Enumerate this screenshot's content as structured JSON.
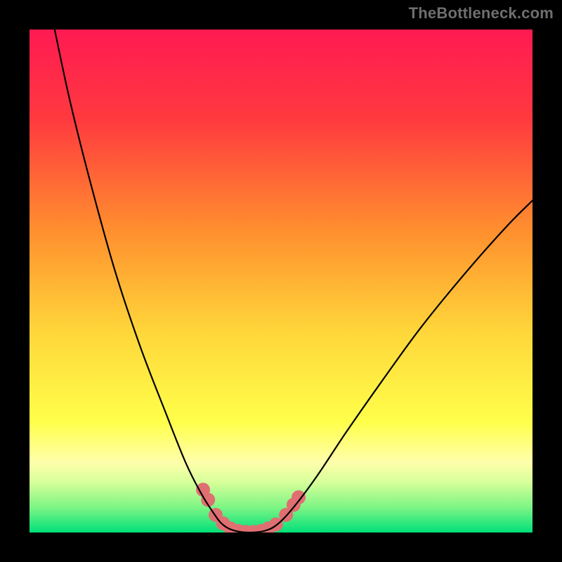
{
  "watermark": "TheBottleneck.com",
  "chart_data": {
    "type": "line",
    "title": "",
    "xlabel": "",
    "ylabel": "",
    "xlim": [
      0,
      100
    ],
    "ylim": [
      0,
      100
    ],
    "background_gradient_stops": [
      {
        "offset": 0,
        "color": "#ff1a52"
      },
      {
        "offset": 0.18,
        "color": "#ff3a3f"
      },
      {
        "offset": 0.4,
        "color": "#ff8f2e"
      },
      {
        "offset": 0.6,
        "color": "#ffd63a"
      },
      {
        "offset": 0.78,
        "color": "#ffff4a"
      },
      {
        "offset": 0.86,
        "color": "#ffffab"
      },
      {
        "offset": 0.9,
        "color": "#d7ff9a"
      },
      {
        "offset": 0.95,
        "color": "#7cf584"
      },
      {
        "offset": 1.0,
        "color": "#00e07a"
      }
    ],
    "curve": {
      "name": "bottleneck-curve",
      "color": "#000000",
      "width": 2.2,
      "points": [
        {
          "x": 5.0,
          "y": 100.0
        },
        {
          "x": 8.0,
          "y": 86.0
        },
        {
          "x": 12.0,
          "y": 70.0
        },
        {
          "x": 17.0,
          "y": 52.0
        },
        {
          "x": 22.0,
          "y": 37.0
        },
        {
          "x": 27.0,
          "y": 24.0
        },
        {
          "x": 31.0,
          "y": 14.0
        },
        {
          "x": 34.0,
          "y": 8.0
        },
        {
          "x": 36.5,
          "y": 4.0
        },
        {
          "x": 38.5,
          "y": 1.5
        },
        {
          "x": 41.0,
          "y": 0.3
        },
        {
          "x": 44.0,
          "y": 0.0
        },
        {
          "x": 47.0,
          "y": 0.4
        },
        {
          "x": 49.5,
          "y": 1.8
        },
        {
          "x": 52.5,
          "y": 5.0
        },
        {
          "x": 57.0,
          "y": 11.0
        },
        {
          "x": 63.0,
          "y": 20.0
        },
        {
          "x": 70.0,
          "y": 30.0
        },
        {
          "x": 78.0,
          "y": 41.0
        },
        {
          "x": 87.0,
          "y": 52.0
        },
        {
          "x": 95.0,
          "y": 61.0
        },
        {
          "x": 100.0,
          "y": 66.0
        }
      ]
    },
    "marker_series": {
      "name": "highlight-dots",
      "color": "#e06f72",
      "radius": 10,
      "points": [
        {
          "x": 34.5,
          "y": 8.5
        },
        {
          "x": 35.5,
          "y": 6.5
        },
        {
          "x": 37.0,
          "y": 3.5
        },
        {
          "x": 38.5,
          "y": 1.8
        },
        {
          "x": 40.0,
          "y": 0.8
        },
        {
          "x": 41.5,
          "y": 0.3
        },
        {
          "x": 43.0,
          "y": 0.1
        },
        {
          "x": 44.5,
          "y": 0.1
        },
        {
          "x": 46.0,
          "y": 0.3
        },
        {
          "x": 47.5,
          "y": 0.8
        },
        {
          "x": 49.0,
          "y": 1.6
        },
        {
          "x": 51.0,
          "y": 3.5
        },
        {
          "x": 52.5,
          "y": 5.5
        },
        {
          "x": 53.5,
          "y": 7.0
        }
      ]
    }
  }
}
